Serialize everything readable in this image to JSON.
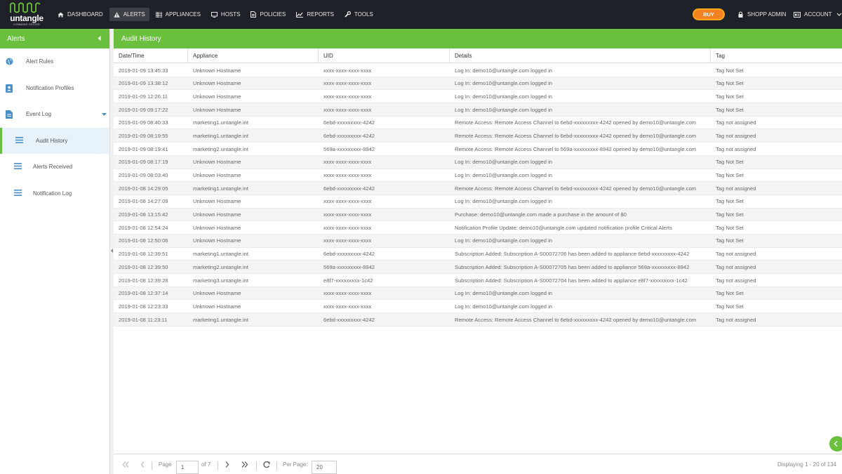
{
  "brand": {
    "name": "untangle",
    "subtitle": "COMMAND CENTER"
  },
  "nav": [
    {
      "label": "DASHBOARD",
      "icon": "home-icon"
    },
    {
      "label": "ALERTS",
      "icon": "warning-icon",
      "active": true
    },
    {
      "label": "APPLIANCES",
      "icon": "grid-icon"
    },
    {
      "label": "HOSTS",
      "icon": "monitor-icon"
    },
    {
      "label": "POLICIES",
      "icon": "document-icon"
    },
    {
      "label": "REPORTS",
      "icon": "chart-icon"
    },
    {
      "label": "TOOLS",
      "icon": "wrench-icon"
    }
  ],
  "buy_label": "BUY",
  "user_label": "SHOPP ADMIN",
  "account_label": "ACCOUNT",
  "sidebar": {
    "title": "Alerts",
    "items": [
      {
        "label": "Alert Rules",
        "icon": "globe-icon"
      },
      {
        "label": "Notification Profiles",
        "icon": "contact-card-icon"
      },
      {
        "label": "Event Log",
        "icon": "document-icon"
      },
      {
        "label": "Audit History",
        "icon": "list-icon"
      },
      {
        "label": "Alerts Received",
        "icon": "list-icon"
      },
      {
        "label": "Notification Log",
        "icon": "list-icon"
      }
    ]
  },
  "panel": {
    "title": "Audit History"
  },
  "table": {
    "columns": [
      "Date/Time",
      "Appliance",
      "UID",
      "Details",
      "Tag"
    ],
    "rows": [
      [
        "2019-01-09 13:45:33",
        "Unknown Hostname",
        "xxxx-xxxx-xxxx-xxxx",
        "Log In: demo10@untangle.com logged in",
        "Tag Not Set"
      ],
      [
        "2019-01-09 13:38:12",
        "Unknown Hostname",
        "xxxx-xxxx-xxxx-xxxx",
        "Log In: demo10@untangle.com logged in",
        "Tag Not Set"
      ],
      [
        "2019-01-09 12:26:11",
        "Unknown Hostname",
        "xxxx-xxxx-xxxx-xxxx",
        "Log In: demo10@untangle.com logged in",
        "Tag Not Set"
      ],
      [
        "2019-01-09 09:17:22",
        "Unknown Hostname",
        "xxxx-xxxx-xxxx-xxxx",
        "Log In: demo10@untangle.com logged in",
        "Tag Not Set"
      ],
      [
        "2019-01-09 08:40:33",
        "marketing1.untangle.int",
        "6ebd-xxxxxxxxx-4242",
        "Remote Access: Remote Access Channel to 6ebd-xxxxxxxxx-4242 opened by demo10@untangle.com",
        "Tag not assigned"
      ],
      [
        "2019-01-09 08:19:55",
        "marketing1.untangle.int",
        "6ebd-xxxxxxxxx-4242",
        "Remote Access: Remote Access Channel to 6ebd-xxxxxxxxx-4242 opened by demo10@untangle.com",
        "Tag not assigned"
      ],
      [
        "2019-01-09 08:19:41",
        "marketing2.untangle.int",
        "569a-xxxxxxxxx-8942",
        "Remote Access: Remote Access Channel to 569a-xxxxxxxxx-8942 opened by demo10@untangle.com",
        "Tag not assigned"
      ],
      [
        "2019-01-09 08:17:19",
        "Unknown Hostname",
        "xxxx-xxxx-xxxx-xxxx",
        "Log In: demo10@untangle.com logged in",
        "Tag Not Set"
      ],
      [
        "2019-01-09 08:03:40",
        "Unknown Hostname",
        "xxxx-xxxx-xxxx-xxxx",
        "Log In: demo10@untangle.com logged in",
        "Tag Not Set"
      ],
      [
        "2019-01-08 14:29:05",
        "marketing1.untangle.int",
        "6ebd-xxxxxxxxx-4242",
        "Remote Access: Remote Access Channel to 6ebd-xxxxxxxxx-4242 opened by demo10@untangle.com",
        "Tag not assigned"
      ],
      [
        "2019-01-08 14:27:09",
        "Unknown Hostname",
        "xxxx-xxxx-xxxx-xxxx",
        "Log In: demo10@untangle.com logged in",
        "Tag Not Set"
      ],
      [
        "2019-01-08 13:15:42",
        "Unknown Hostname",
        "xxxx-xxxx-xxxx-xxxx",
        "Purchase: demo10@untangle.com made a purchase in the amount of $0",
        "Tag Not Set"
      ],
      [
        "2019-01-08 12:54:24",
        "Unknown Hostname",
        "xxxx-xxxx-xxxx-xxxx",
        "Notification Profile Update: demo10@untangle.com updated notification profile Critical Alerts",
        "Tag Not Set"
      ],
      [
        "2019-01-08 12:50:06",
        "Unknown Hostname",
        "xxxx-xxxx-xxxx-xxxx",
        "Log In: demo10@untangle.com logged in",
        "Tag Not Set"
      ],
      [
        "2019-01-08 12:39:51",
        "marketing1.untangle.int",
        "6ebd-xxxxxxxxx-4242",
        "Subscription Added: Subscription A-S00072706 has been added to appliance 6ebd-xxxxxxxxx-4242",
        "Tag not assigned"
      ],
      [
        "2019-01-08 12:39:50",
        "marketing2.untangle.int",
        "569a-xxxxxxxxx-8942",
        "Subscription Added: Subscription A-S00072705 has been added to appliance 569a-xxxxxxxxx-8942",
        "Tag not assigned"
      ],
      [
        "2019-01-08 12:39:28",
        "marketing3.untangle.int",
        "e8f7-xxxxxxxxx-1c42",
        "Subscription Added: Subscription A-S00072704 has been added to appliance e8f7-xxxxxxxxx-1c42",
        "Tag not assigned"
      ],
      [
        "2019-01-08 12:37:14",
        "Unknown Hostname",
        "xxxx-xxxx-xxxx-xxxx",
        "Log In: demo10@untangle.com logged in",
        "Tag Not Set"
      ],
      [
        "2019-01-08 12:23:33",
        "Unknown Hostname",
        "xxxx-xxxx-xxxx-xxxx",
        "Log In: demo10@untangle.com logged in",
        "Tag Not Set"
      ],
      [
        "2019-01-08 11:23:11",
        "marketing1.untangle.int",
        "6ebd-xxxxxxxxx-4242",
        "Remote Access: Remote Access Channel to 6ebd-xxxxxxxxx-4242 opened by demo10@untangle.com",
        "Tag not assigned"
      ]
    ]
  },
  "pager": {
    "page_label": "Page",
    "page_value": "1",
    "of_label": "of 7",
    "per_page_label": "Per Page:",
    "per_page_value": "20",
    "displaying": "Displaying 1 - 20 of 134"
  },
  "colors": {
    "accent": "#6abf3e",
    "nav_bg": "#1e2128",
    "buy": "#f58220"
  }
}
